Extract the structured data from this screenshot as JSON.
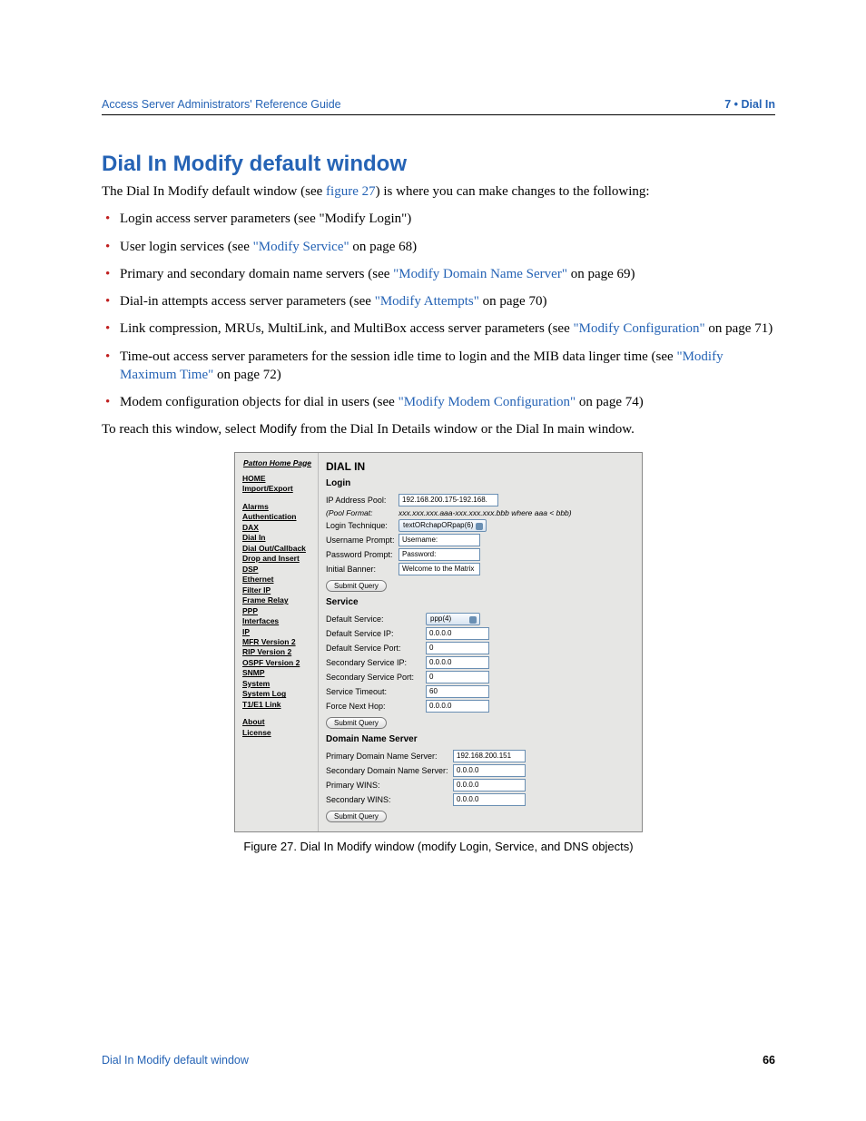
{
  "header": {
    "left": "Access Server Administrators' Reference Guide",
    "right": "7 • Dial In"
  },
  "title": "Dial In Modify default window",
  "intro_a": "The Dial In Modify default window (see ",
  "intro_ref": "figure 27",
  "intro_b": ") is where you can make changes to the following:",
  "bullets": [
    {
      "plain": "Login access server parameters (see \"Modify Login\")"
    },
    {
      "pre": "User login services (see ",
      "link": "\"Modify Service\"",
      "post": " on page 68)"
    },
    {
      "pre": "Primary and secondary domain name servers (see ",
      "link": "\"Modify Domain Name Server\"",
      "post": " on page 69)"
    },
    {
      "pre": "Dial-in attempts access server parameters (see ",
      "link": "\"Modify Attempts\"",
      "post": " on page 70)"
    },
    {
      "pre": "Link compression, MRUs, MultiLink, and MultiBox access server parameters (see ",
      "link": "\"Modify Configuration\"",
      "post": " on page 71)"
    },
    {
      "pre": "Time-out access server parameters for the session idle time to login and the MIB data linger time (see ",
      "link": "\"Modify Maximum Time\"",
      "post": " on page 72)"
    },
    {
      "pre": "Modem configuration objects for dial in users (see ",
      "link": "\"Modify Modem Configuration\"",
      "post": " on page 74)"
    }
  ],
  "outro_a": "To reach this window, select ",
  "outro_ui": "Modify",
  "outro_b": " from the Dial In Details window or the Dial In main window.",
  "fig": {
    "nav_title": "Patton Home Page",
    "nav_groups": [
      [
        "HOME",
        "Import/Export"
      ],
      [
        "Alarms",
        "Authentication",
        "DAX",
        "Dial In",
        "Dial Out/Callback",
        "Drop and Insert",
        "DSP",
        "Ethernet",
        "Filter IP",
        "Frame Relay",
        "PPP",
        "Interfaces",
        "IP",
        "MFR Version 2",
        "RIP Version 2",
        "OSPF Version 2",
        "SNMP",
        "System",
        "System Log",
        "T1/E1 Link"
      ],
      [
        "About",
        "License"
      ]
    ],
    "main_title": "DIAL IN",
    "login": {
      "heading": "Login",
      "ip_pool_label": "IP Address Pool:",
      "ip_pool_value": "192.168.200.175-192.168.",
      "pool_format_label": "(Pool Format:",
      "pool_format_hint": "xxx.xxx.xxx.aaa-xxx.xxx.xxx.bbb where aaa < bbb)",
      "login_tech_label": "Login Technique:",
      "login_tech_value": "textORchapORpap(6)",
      "user_prompt_label": "Username Prompt:",
      "user_prompt_value": "Username:",
      "pass_prompt_label": "Password Prompt:",
      "pass_prompt_value": "Password:",
      "banner_label": "Initial Banner:",
      "banner_value": "Welcome to the Matrix",
      "submit": "Submit Query"
    },
    "service": {
      "heading": "Service",
      "default_service_label": "Default Service:",
      "default_service_value": "ppp(4)",
      "default_ip_label": "Default Service IP:",
      "default_ip_value": "0.0.0.0",
      "default_port_label": "Default Service Port:",
      "default_port_value": "0",
      "sec_ip_label": "Secondary Service IP:",
      "sec_ip_value": "0.0.0.0",
      "sec_port_label": "Secondary Service Port:",
      "sec_port_value": "0",
      "timeout_label": "Service Timeout:",
      "timeout_value": "60",
      "nexthop_label": "Force Next Hop:",
      "nexthop_value": "0.0.0.0",
      "submit": "Submit Query"
    },
    "dns": {
      "heading": "Domain Name Server",
      "primary_dns_label": "Primary Domain Name Server:",
      "primary_dns_value": "192.168.200.151",
      "secondary_dns_label": "Secondary Domain Name Server:",
      "secondary_dns_value": "0.0.0.0",
      "primary_wins_label": "Primary WINS:",
      "primary_wins_value": "0.0.0.0",
      "secondary_wins_label": "Secondary WINS:",
      "secondary_wins_value": "0.0.0.0",
      "submit": "Submit Query"
    }
  },
  "caption": "Figure 27. Dial In Modify window (modify Login, Service, and DNS objects)",
  "footer": {
    "left": "Dial In Modify default window",
    "right": "66"
  }
}
